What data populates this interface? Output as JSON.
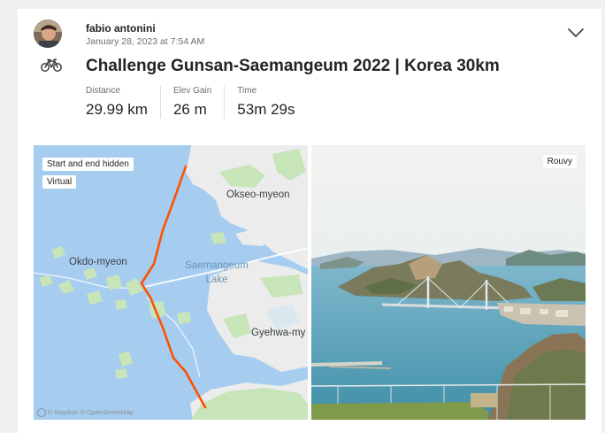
{
  "athlete": {
    "name": "fabio antonini",
    "timestamp": "January 28, 2023 at 7:54 AM"
  },
  "activity": {
    "sport_icon": "bike-icon",
    "title": "Challenge Gunsan-Saemangeum 2022 | Korea 30km",
    "stats": [
      {
        "label": "Distance",
        "value": "29.99 km"
      },
      {
        "label": "Elev Gain",
        "value": "26 m"
      },
      {
        "label": "Time",
        "value": "53m 29s"
      }
    ]
  },
  "map": {
    "tags": [
      "Start and end hidden",
      "Virtual"
    ],
    "places": {
      "okseo": "Okseo-myeon",
      "okdo": "Okdo-myeon",
      "gyehwa": "Gyehwa-my"
    },
    "lake_line1": "Saemangeum",
    "lake_line2": "Lake",
    "attribution": "© Mapbox © OpenStreetMap",
    "route_color": "#fc5200"
  },
  "photo": {
    "tag": "Rouvy"
  },
  "colors": {
    "water": "#a6cdf0",
    "land": "#ebeceb",
    "park": "#c7e5b9"
  }
}
